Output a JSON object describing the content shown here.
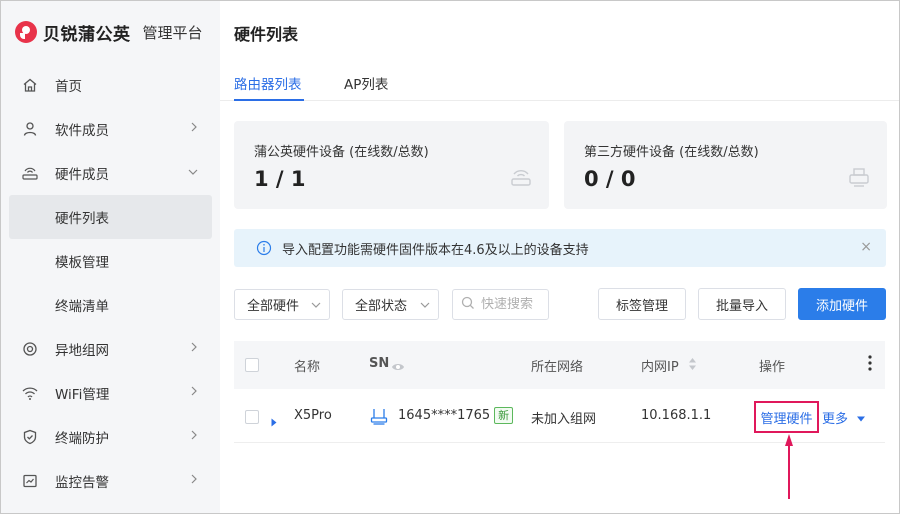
{
  "brand": {
    "name": "贝锐蒲公英",
    "subtitle": "管理平台"
  },
  "sidebar": {
    "items": [
      {
        "label": "首页"
      },
      {
        "label": "软件成员"
      },
      {
        "label": "硬件成员"
      },
      {
        "label": "硬件列表"
      },
      {
        "label": "模板管理"
      },
      {
        "label": "终端清单"
      },
      {
        "label": "异地组网"
      },
      {
        "label": "WiFi管理"
      },
      {
        "label": "终端防护"
      },
      {
        "label": "监控告警"
      }
    ]
  },
  "main": {
    "title": "硬件列表",
    "tabs": [
      {
        "label": "路由器列表"
      },
      {
        "label": "AP列表"
      }
    ],
    "cards": [
      {
        "label": "蒲公英硬件设备 (在线数/总数)",
        "value": "1 / 1"
      },
      {
        "label": "第三方硬件设备 (在线数/总数)",
        "value": "0 / 0"
      }
    ],
    "notice": {
      "text": "导入配置功能需硬件固件版本在4.6及以上的设备支持",
      "close": "×"
    },
    "filters": {
      "hardware": "全部硬件",
      "status": "全部状态",
      "search_placeholder": "快速搜索"
    },
    "buttons": {
      "tag": "标签管理",
      "import": "批量导入",
      "add": "添加硬件"
    },
    "table": {
      "headers": {
        "name": "名称",
        "sn": "SN",
        "network": "所在网络",
        "ip": "内网IP",
        "ops": "操作"
      },
      "rows": [
        {
          "name": "X5Pro",
          "sn": "1645****1765",
          "badge": "新",
          "network": "未加入组网",
          "ip": "10.168.1.1",
          "manage": "管理硬件",
          "more": "更多"
        }
      ]
    }
  },
  "colors": {
    "primary": "#2b7de9",
    "link": "#2b6ee6",
    "highlight": "#e0185b",
    "brand": "#e8334a"
  }
}
